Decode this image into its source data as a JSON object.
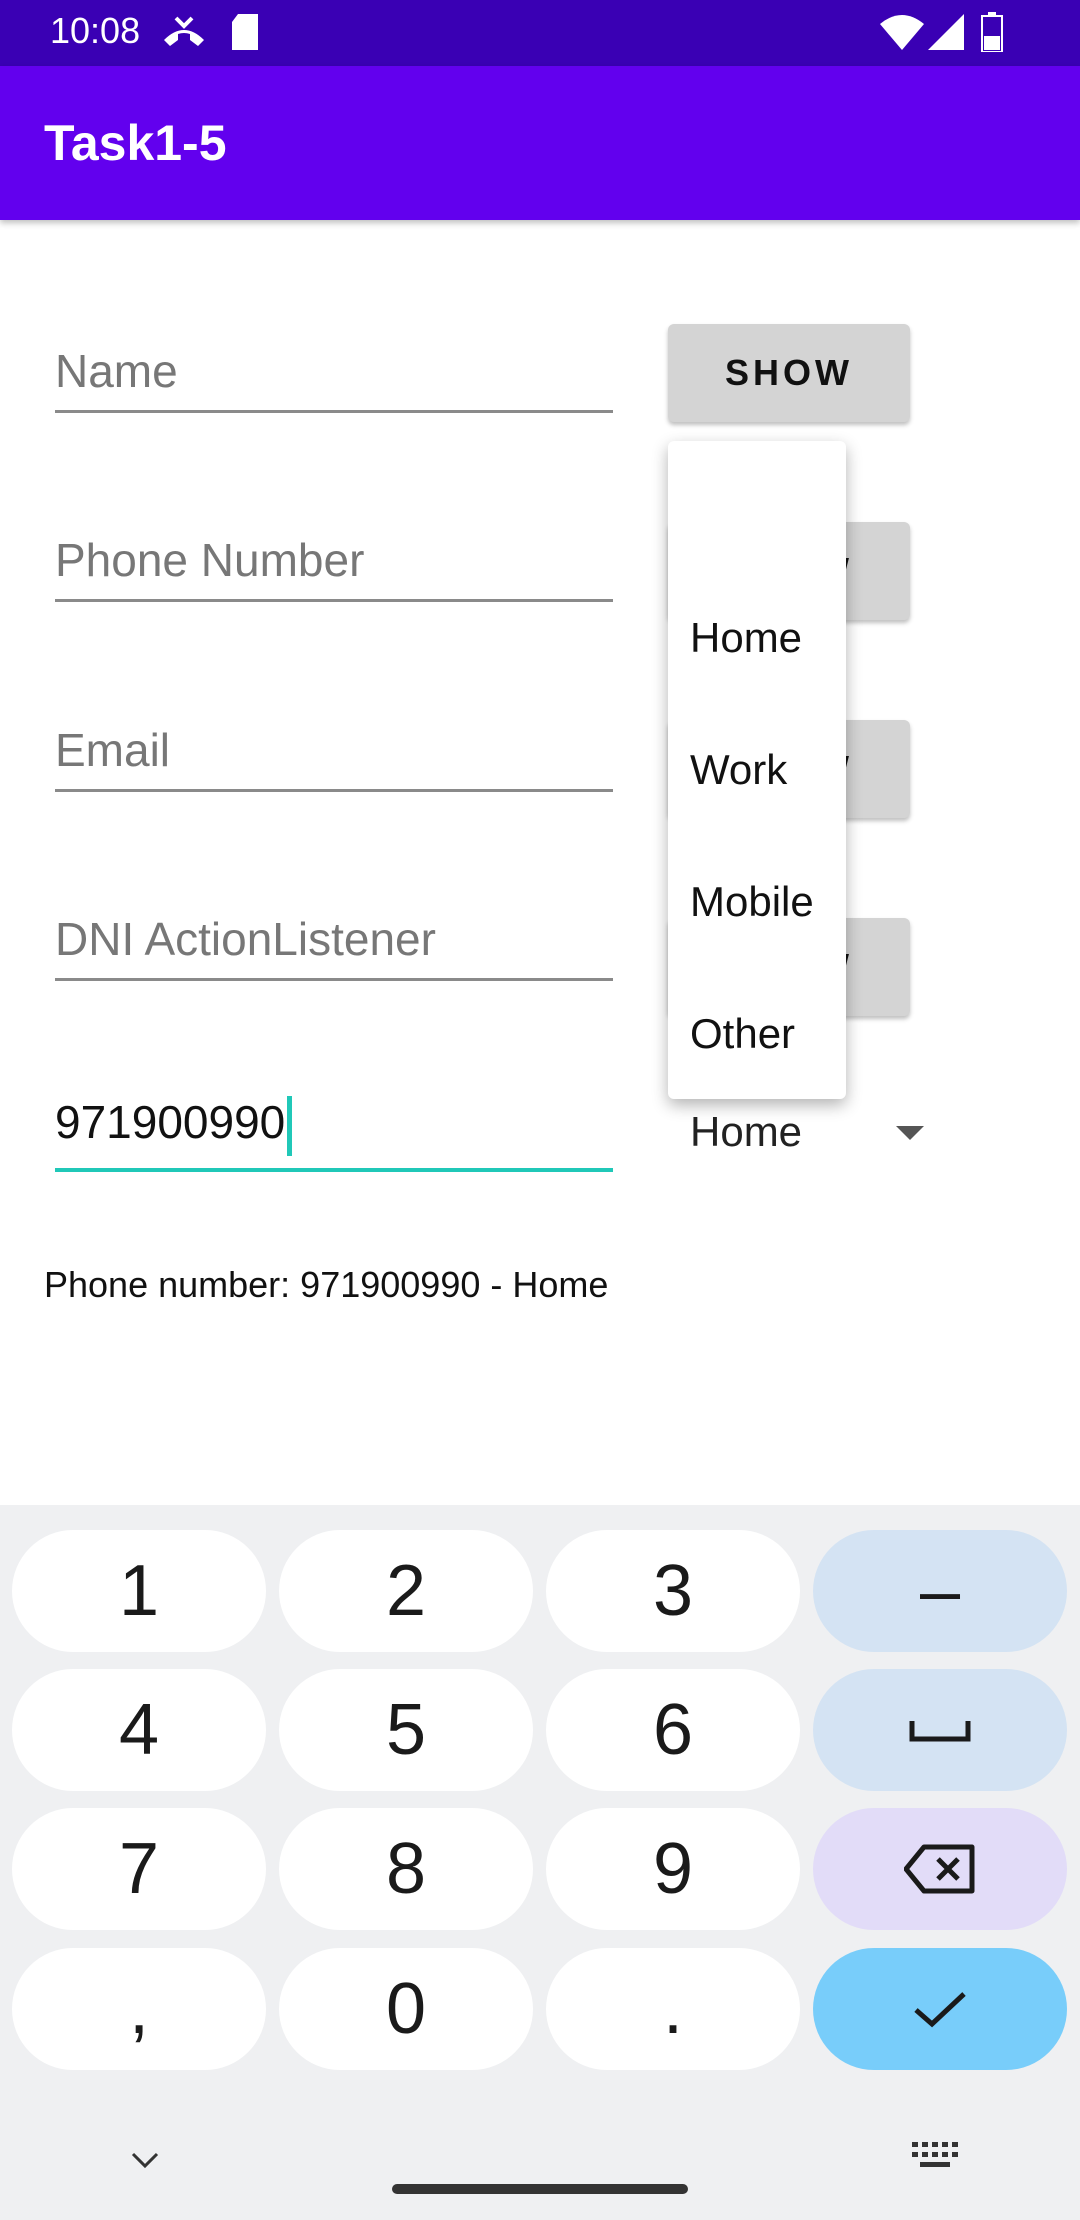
{
  "status": {
    "time": "10:08"
  },
  "app": {
    "title": "Task1-5"
  },
  "fields": [
    {
      "placeholder": "Name"
    },
    {
      "placeholder": "Phone Number"
    },
    {
      "placeholder": "Email"
    },
    {
      "placeholder": "DNI ActionListener"
    }
  ],
  "buttons": {
    "show_label": "SHOW"
  },
  "phone_input": {
    "value": "971900990"
  },
  "spinner": {
    "selected": "Home",
    "options": [
      "Home",
      "Work",
      "Mobile",
      "Other"
    ]
  },
  "result": {
    "text": "Phone number: 971900990 - Home"
  },
  "keyboard": {
    "rows": [
      [
        "1",
        "2",
        "3",
        "–"
      ],
      [
        "4",
        "5",
        "6",
        "space"
      ],
      [
        "7",
        "8",
        "9",
        "backspace"
      ],
      [
        ",",
        "0",
        ".",
        "enter"
      ]
    ]
  },
  "colors": {
    "status_bar": "#3a00b4",
    "app_bar": "#6200ee",
    "accent": "#20c8b8",
    "enter_key": "#78cdfa"
  }
}
